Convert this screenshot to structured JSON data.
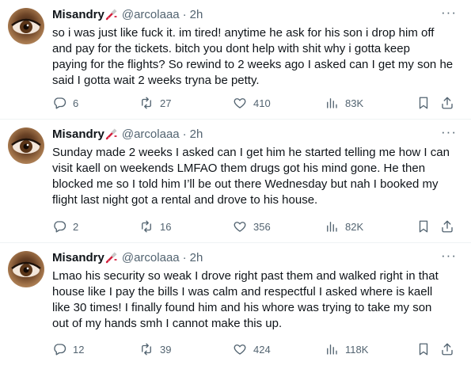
{
  "tweets": [
    {
      "name": "Misandry",
      "handle": "@arcolaaa",
      "separator": "·",
      "time": "2h",
      "more": "···",
      "lines": [
        "so i was just like fuck it. im tired! anytime he ask for his son i drop him off",
        "and pay for the tickets. bitch you dont help with shit why i gotta keep",
        "paying for the flights? So rewind to 2 weeks ago I asked can I get my son he",
        "said I gotta wait 2 weeks tryna be petty."
      ],
      "replies": "6",
      "retweets": "27",
      "likes": "410",
      "views": "83K"
    },
    {
      "name": "Misandry",
      "handle": "@arcolaaa",
      "separator": "·",
      "time": "2h",
      "more": "···",
      "lines": [
        "Sunday made 2 weeks I asked can I get him he started telling me how I can",
        "visit kaell on weekends LMFAO them drugs got his mind gone. He then",
        "blocked me so I told him I’ll be out there Wednesday but nah I booked my",
        "flight last night got a rental and drove to his house."
      ],
      "replies": "2",
      "retweets": "16",
      "likes": "356",
      "views": "82K"
    },
    {
      "name": "Misandry",
      "handle": "@arcolaaa",
      "separator": "·",
      "time": "2h",
      "more": "···",
      "lines": [
        "Lmao his security so weak I drove right past them and walked right in that",
        "house like I pay the bills I was calm and respectful I asked where is kaell",
        "like 30 times! I finally found him and his whore was trying to take my son",
        "out of my hands smh I cannot make this up."
      ],
      "replies": "12",
      "retweets": "39",
      "likes": "424",
      "views": "118K"
    }
  ],
  "colors": {
    "text": "#0f1419",
    "secondary": "#536471",
    "divider": "#eff3f4",
    "nail_polish": "#d21f3c"
  },
  "icons": {
    "name_emoji": "nail-polish-icon",
    "reply": "reply-icon",
    "retweet": "retweet-icon",
    "like": "like-icon",
    "views": "views-icon",
    "bookmark": "bookmark-icon",
    "share": "share-icon"
  }
}
